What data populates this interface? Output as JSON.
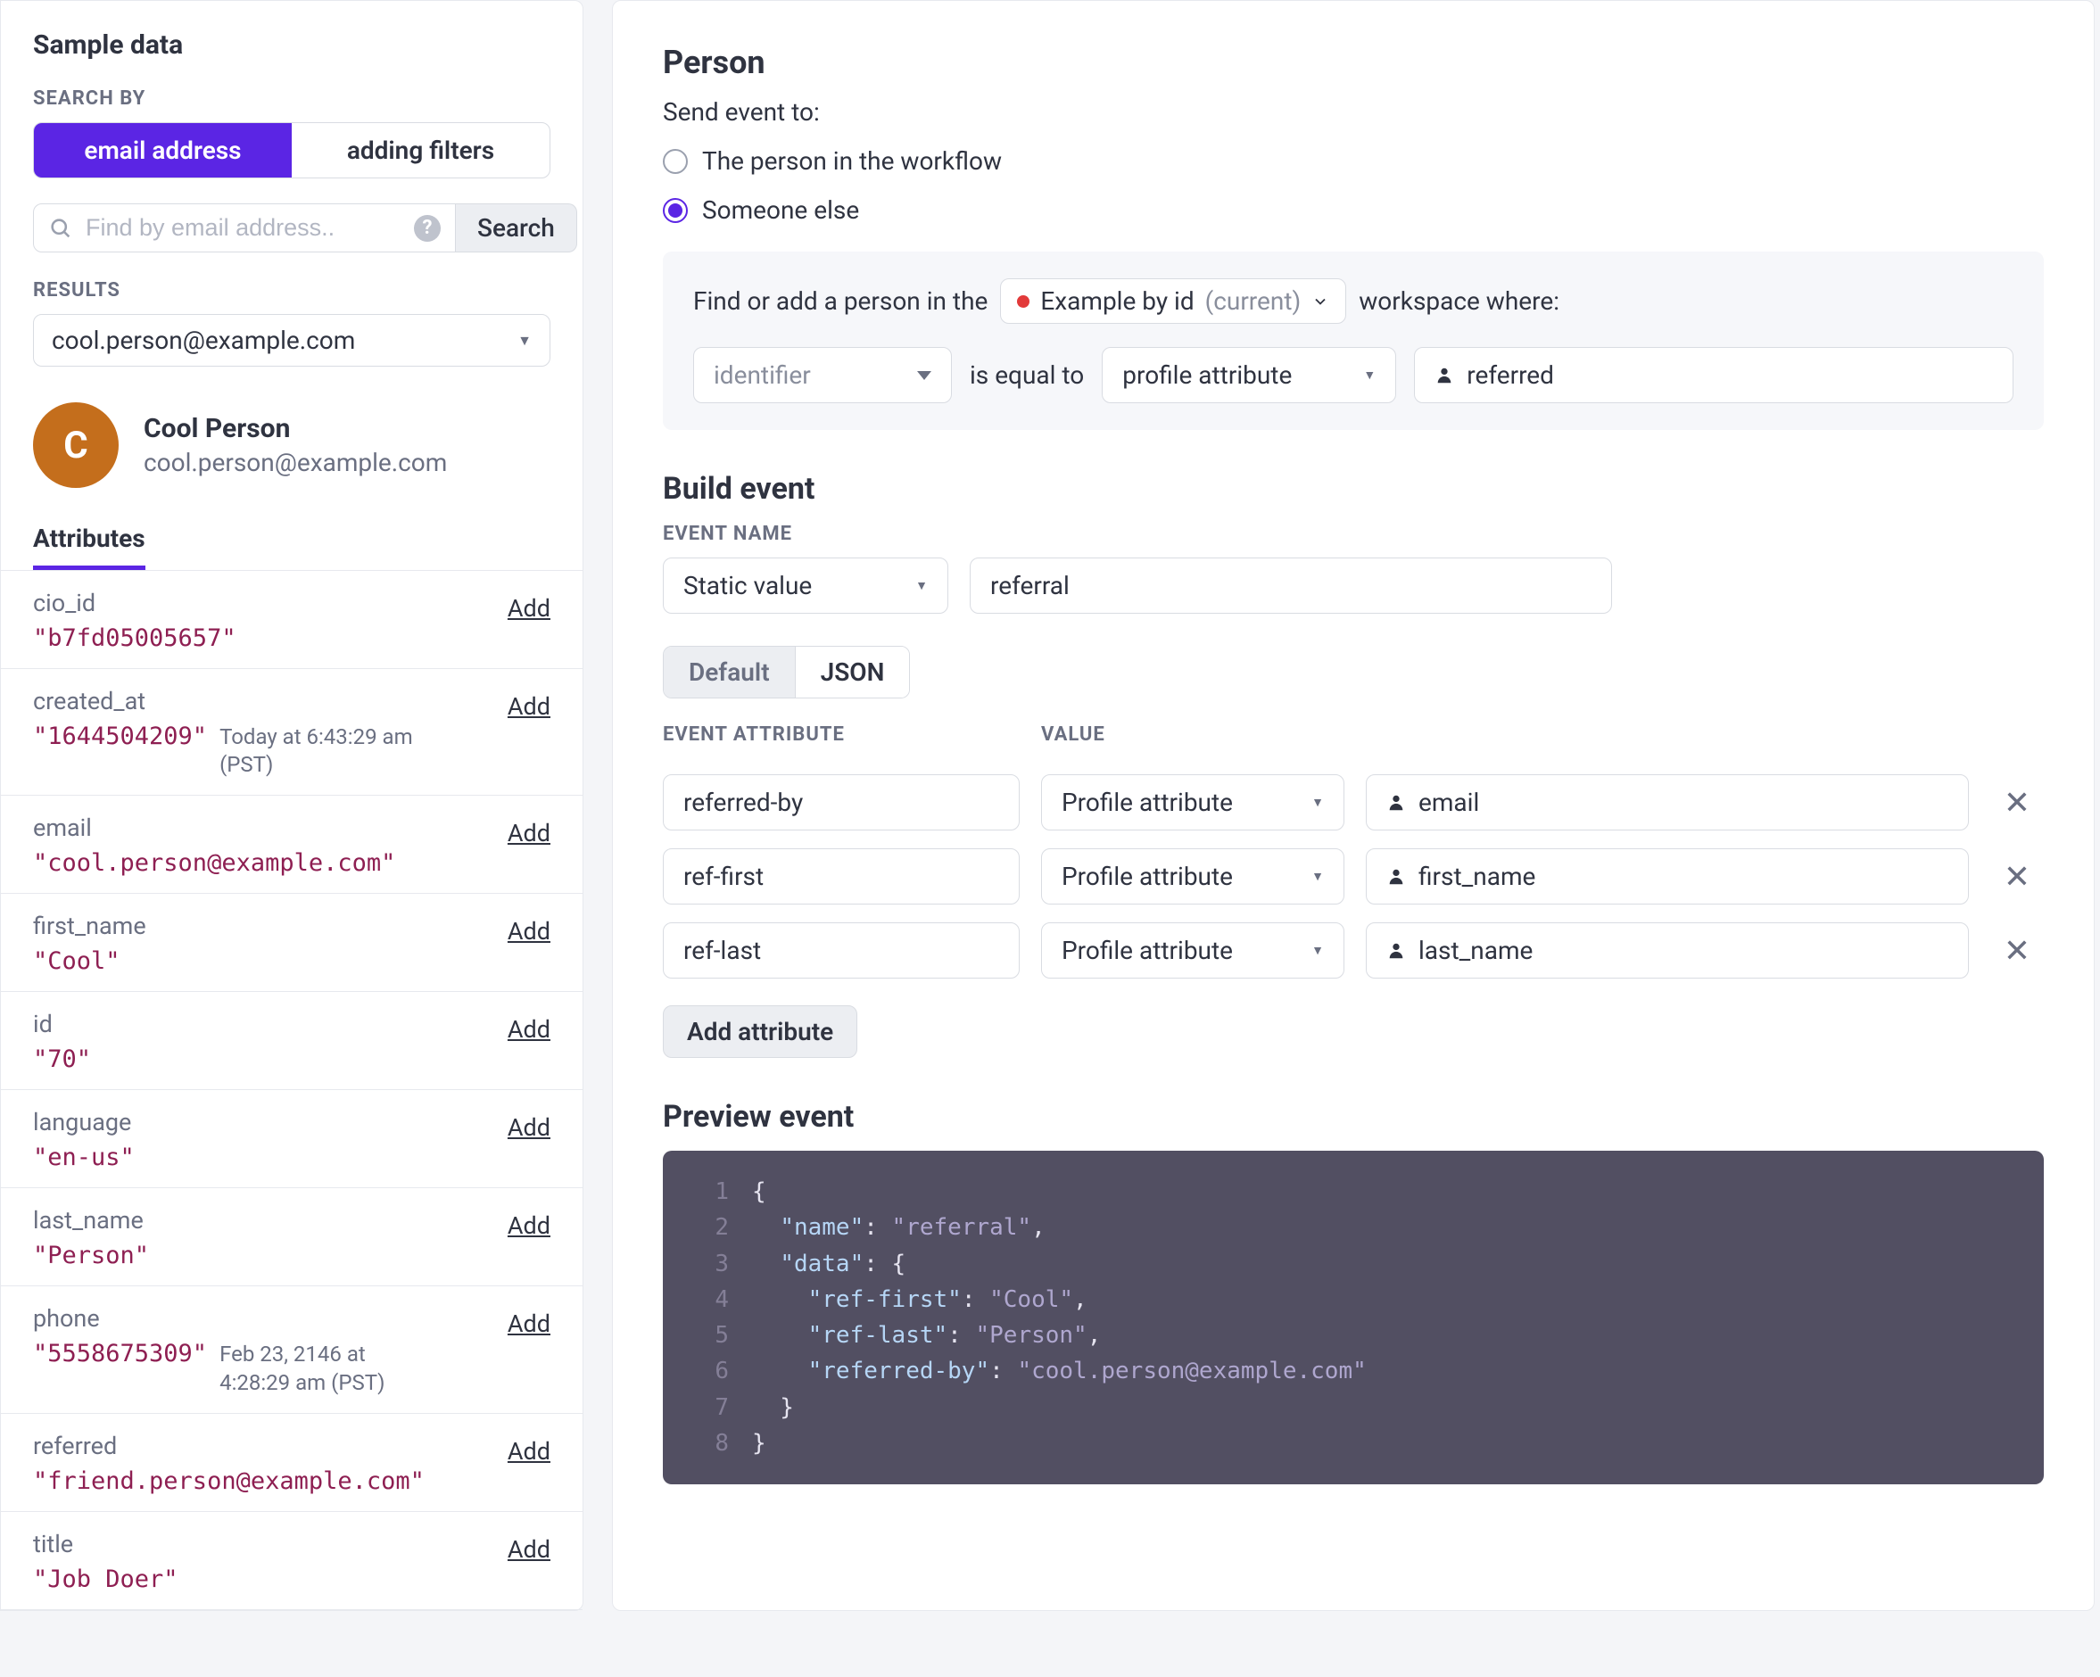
{
  "sidebar": {
    "title": "Sample data",
    "search_by_label": "SEARCH BY",
    "seg_email": "email address",
    "seg_filters": "adding filters",
    "search_placeholder": "Find by email address..",
    "search_btn": "Search",
    "results_label": "RESULTS",
    "results_value": "cool.person@example.com",
    "avatar_letter": "C",
    "person_name": "Cool Person",
    "person_email": "cool.person@example.com",
    "tab_attributes": "Attributes",
    "add_label": "Add",
    "attrs": [
      {
        "key": "cio_id",
        "val": "\"b7fd05005657\"",
        "note": ""
      },
      {
        "key": "created_at",
        "val": "\"1644504209\"",
        "note": "Today at 6:43:29 am (PST)"
      },
      {
        "key": "email",
        "val": "\"cool.person@example.com\"",
        "note": ""
      },
      {
        "key": "first_name",
        "val": "\"Cool\"",
        "note": ""
      },
      {
        "key": "id",
        "val": "\"70\"",
        "note": ""
      },
      {
        "key": "language",
        "val": "\"en-us\"",
        "note": ""
      },
      {
        "key": "last_name",
        "val": "\"Person\"",
        "note": ""
      },
      {
        "key": "phone",
        "val": "\"5558675309\"",
        "note": "Feb 23, 2146 at 4:28:29 am (PST)"
      },
      {
        "key": "referred",
        "val": "\"friend.person@example.com\"",
        "note": ""
      },
      {
        "key": "title",
        "val": "\"Job Doer\"",
        "note": ""
      }
    ]
  },
  "main": {
    "heading_person": "Person",
    "send_to_label": "Send event to:",
    "radio1": "The person in the workflow",
    "radio2": "Someone else",
    "find_prefix": "Find or add a person in the",
    "workspace_name": "Example by id",
    "workspace_suffix": "(current)",
    "find_suffix": "workspace where:",
    "identifier_placeholder": "identifier",
    "is_equal": "is equal to",
    "profile_attr": "profile attribute",
    "referred_val": "referred",
    "heading_build": "Build event",
    "event_name_label": "EVENT NAME",
    "static_value": "Static value",
    "event_name_value": "referral",
    "pill_default": "Default",
    "pill_json": "JSON",
    "col_attr": "EVENT ATTRIBUTE",
    "col_value": "VALUE",
    "rows": [
      {
        "attr": "referred-by",
        "type": "Profile attribute",
        "val": "email"
      },
      {
        "attr": "ref-first",
        "type": "Profile attribute",
        "val": "first_name"
      },
      {
        "attr": "ref-last",
        "type": "Profile attribute",
        "val": "last_name"
      }
    ],
    "add_attribute": "Add attribute",
    "heading_preview": "Preview event",
    "code_lines": [
      {
        "n": "1",
        "indent": 0,
        "plain": "{"
      },
      {
        "n": "2",
        "indent": 1,
        "key": "\"name\"",
        "sep": ": ",
        "str": "\"referral\"",
        "tail": ","
      },
      {
        "n": "3",
        "indent": 1,
        "key": "\"data\"",
        "sep": ": ",
        "plain_after": "{"
      },
      {
        "n": "4",
        "indent": 2,
        "key": "\"ref-first\"",
        "sep": ": ",
        "str": "\"Cool\"",
        "tail": ","
      },
      {
        "n": "5",
        "indent": 2,
        "key": "\"ref-last\"",
        "sep": ": ",
        "str": "\"Person\"",
        "tail": ","
      },
      {
        "n": "6",
        "indent": 2,
        "key": "\"referred-by\"",
        "sep": ": ",
        "str": "\"cool.person@example.com\""
      },
      {
        "n": "7",
        "indent": 1,
        "plain": "}"
      },
      {
        "n": "8",
        "indent": 0,
        "plain": "}"
      }
    ]
  }
}
